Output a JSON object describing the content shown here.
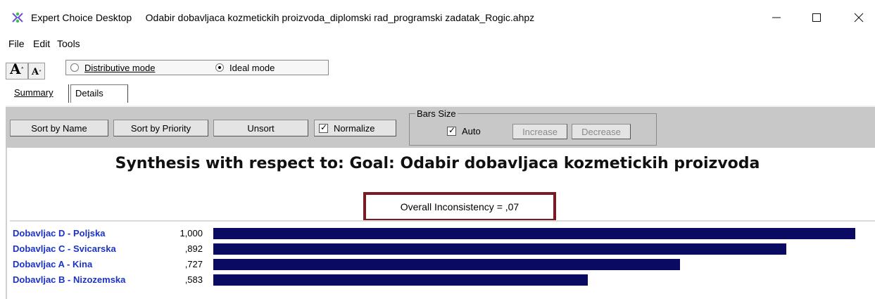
{
  "window": {
    "app_name": "Expert Choice Desktop",
    "file_name": "Odabir dobavljaca kozmetickih proizvoda_diplomski rad_programski zadatak_Rogic.ahpz",
    "minimize": "—",
    "maximize": "☐",
    "close": "✕"
  },
  "menu": {
    "items": [
      "File",
      "Edit",
      "Tools"
    ]
  },
  "toolbar": {
    "font_increase": "A",
    "font_decrease": "A",
    "modes": [
      {
        "label": "Distributive mode",
        "selected": false
      },
      {
        "label": "Ideal mode",
        "selected": true
      }
    ]
  },
  "tabs": [
    "Summary",
    "Details"
  ],
  "controls": {
    "sort_by_name": "Sort by Name",
    "sort_by_priority": "Sort by Priority",
    "unsort": "Unsort",
    "normalize": "Normalize",
    "normalize_checked": true,
    "bars_size_title": "Bars Size",
    "auto": "Auto",
    "auto_checked": true,
    "increase": "Increase",
    "decrease": "Decrease"
  },
  "synthesis": {
    "title": "Synthesis with respect to: Goal: Odabir dobavljaca kozmetickih proizvoda",
    "inconsistency": "Overall Inconsistency = ,07"
  },
  "colors": {
    "bar": "#0a0a63",
    "alt_name": "#1a32c8",
    "highlight_border": "#7a1a24"
  },
  "chart_data": {
    "type": "bar",
    "categories": [
      "Dobavljac D - Poljska",
      "Dobavljac C - Svicarska",
      "Dobavljac A - Kina",
      "Dobavljac B - Nizozemska"
    ],
    "value_labels": [
      "1,000",
      ",892",
      ",727",
      ",583"
    ],
    "values": [
      1.0,
      0.892,
      0.727,
      0.583
    ],
    "title": "Synthesis with respect to: Goal: Odabir dobavljaca kozmetickih proizvoda",
    "xlabel": "",
    "ylabel": "",
    "xlim": [
      0,
      1
    ]
  }
}
